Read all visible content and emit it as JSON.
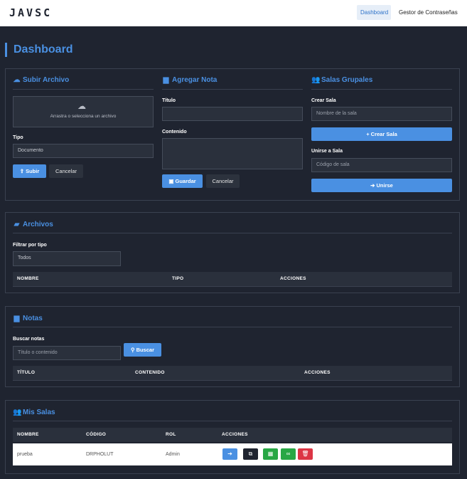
{
  "nav": {
    "logo": "JAVSC",
    "dashboard": "Dashboard",
    "password_manager": "Gestor de Contraseñas"
  },
  "page": {
    "title": "Dashboard"
  },
  "upload": {
    "title": "Subir Archivo",
    "dropzone_text": "Arrastra o selecciona un archivo",
    "type_label": "Tipo",
    "type_value": "Documento",
    "submit": "Subir",
    "cancel": "Cancelar"
  },
  "note": {
    "title": "Agregar Nota",
    "title_label": "Título",
    "content_label": "Contenido",
    "save": "Guardar",
    "cancel": "Cancelar"
  },
  "rooms_group": {
    "title": "Salas Grupales",
    "create_label": "Crear Sala",
    "create_placeholder": "Nombre de la sala",
    "create_button": "Crear Sala",
    "join_label": "Unirse a Sala",
    "join_placeholder": "Código de sala",
    "join_button": "Unirse"
  },
  "files": {
    "title": "Archivos",
    "filter_label": "Filtrar por tipo",
    "filter_value": "Todos",
    "columns": [
      "NOMBRE",
      "TIPO",
      "ACCIONES"
    ]
  },
  "notes": {
    "title": "Notas",
    "search_label": "Buscar notas",
    "search_placeholder": "Título o contenido",
    "search_button": "Buscar",
    "columns": [
      "TÍTULO",
      "CONTENIDO",
      "ACCIONES"
    ]
  },
  "my_rooms": {
    "title": "Mis Salas",
    "columns": [
      "NOMBRE",
      "CÓDIGO",
      "ROL",
      "ACCIONES"
    ],
    "rows": [
      {
        "name": "prueba",
        "code": "DRPHOLUT",
        "role": "Admin"
      }
    ],
    "action_icons": [
      "enter-icon",
      "copy-icon",
      "grid-icon",
      "link-icon",
      "trash-icon"
    ],
    "action_colors": [
      "#4a90e2",
      "#1f2430",
      "#28a745",
      "#28a745",
      "#dc3545"
    ]
  },
  "colors": {
    "accent": "#4a90e2",
    "background": "#1f2430",
    "success": "#28a745",
    "danger": "#dc3545"
  }
}
